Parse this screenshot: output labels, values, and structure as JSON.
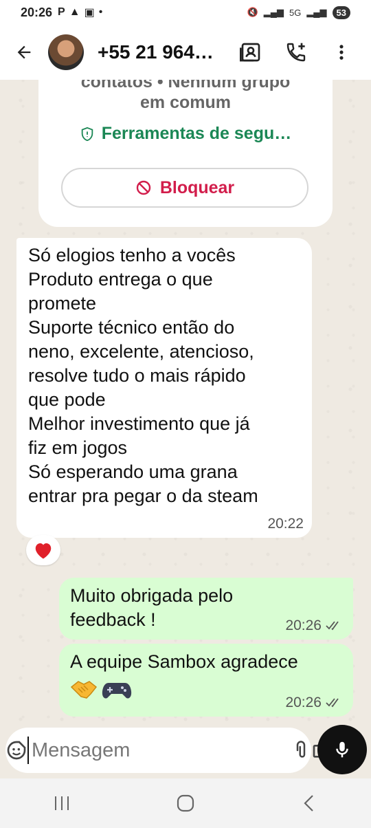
{
  "status_bar": {
    "time": "20:26",
    "network": "5G",
    "battery": "53"
  },
  "header": {
    "title": "+55 21 964…",
    "back_icon": "arrow-left-icon",
    "contact_card_icon": "contact-card-icon",
    "add_call_icon": "add-call-icon",
    "menu_icon": "more-vert-icon"
  },
  "system_notice": {
    "line1": "contatos • Nenhum grupo",
    "line2": "em comum",
    "safety_tools_label": "Ferramentas de segu…",
    "block_label": "Bloquear"
  },
  "messages": [
    {
      "direction": "incoming",
      "text": "Só elogios tenho a vocês\nProduto entrega o que\npromete\nSuporte técnico então do\nneno, excelente, atencioso,\nresolve tudo o mais rápido\nque pode\nMelhor investimento que já\nfiz em jogos\nSó esperando uma grana\nentrar pra pegar o da steam",
      "time": "20:22",
      "reaction": "❤️"
    },
    {
      "direction": "outgoing",
      "text": "Muito obrigada pelo\nfeedback !",
      "time": "20:26",
      "status": "read"
    },
    {
      "direction": "outgoing",
      "text": "A equipe Sambox agradece",
      "emojis": [
        "🤝",
        "🎮"
      ],
      "time": "20:26",
      "status": "read"
    }
  ],
  "composer": {
    "placeholder": "Mensagem"
  },
  "colors": {
    "chat_bg": "#efeae2",
    "outgoing_bubble": "#d9fdd3",
    "safety_green": "#1b8755",
    "block_red": "#d21d4b"
  }
}
